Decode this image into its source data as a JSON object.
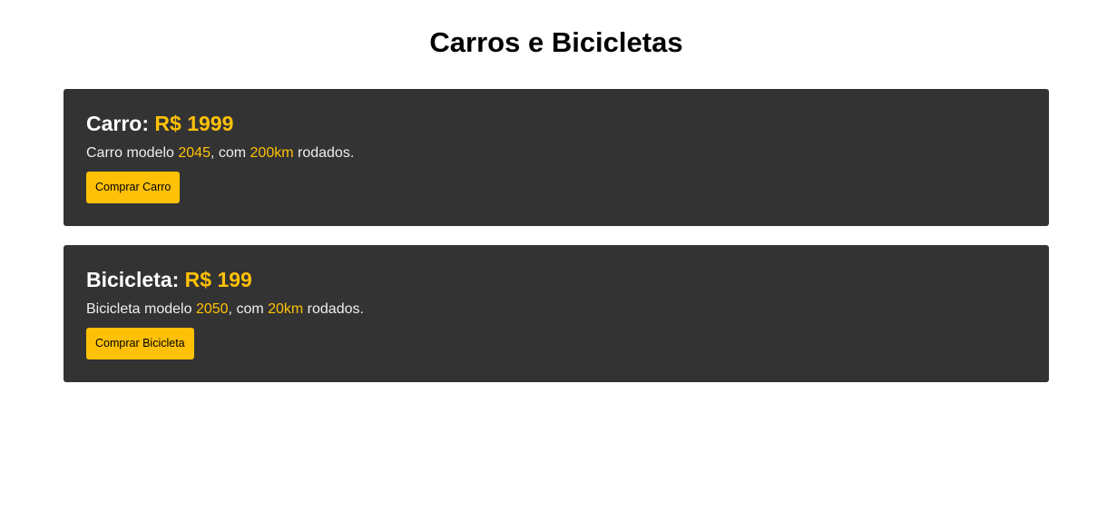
{
  "page": {
    "title": "Carros e Bicicletas"
  },
  "colors": {
    "card_background": "#333333",
    "accent": "#ffc107",
    "text_light": "#ffffff"
  },
  "items": [
    {
      "label": "Carro:",
      "price": "R$ 1999",
      "desc_prefix": "Carro modelo ",
      "model": "2045",
      "desc_middle": ", com ",
      "km": "200km",
      "desc_suffix": " rodados.",
      "button_label": "Comprar Carro"
    },
    {
      "label": "Bicicleta:",
      "price": "R$ 199",
      "desc_prefix": "Bicicleta modelo ",
      "model": "2050",
      "desc_middle": ", com ",
      "km": "20km",
      "desc_suffix": " rodados.",
      "button_label": "Comprar Bicicleta"
    }
  ]
}
